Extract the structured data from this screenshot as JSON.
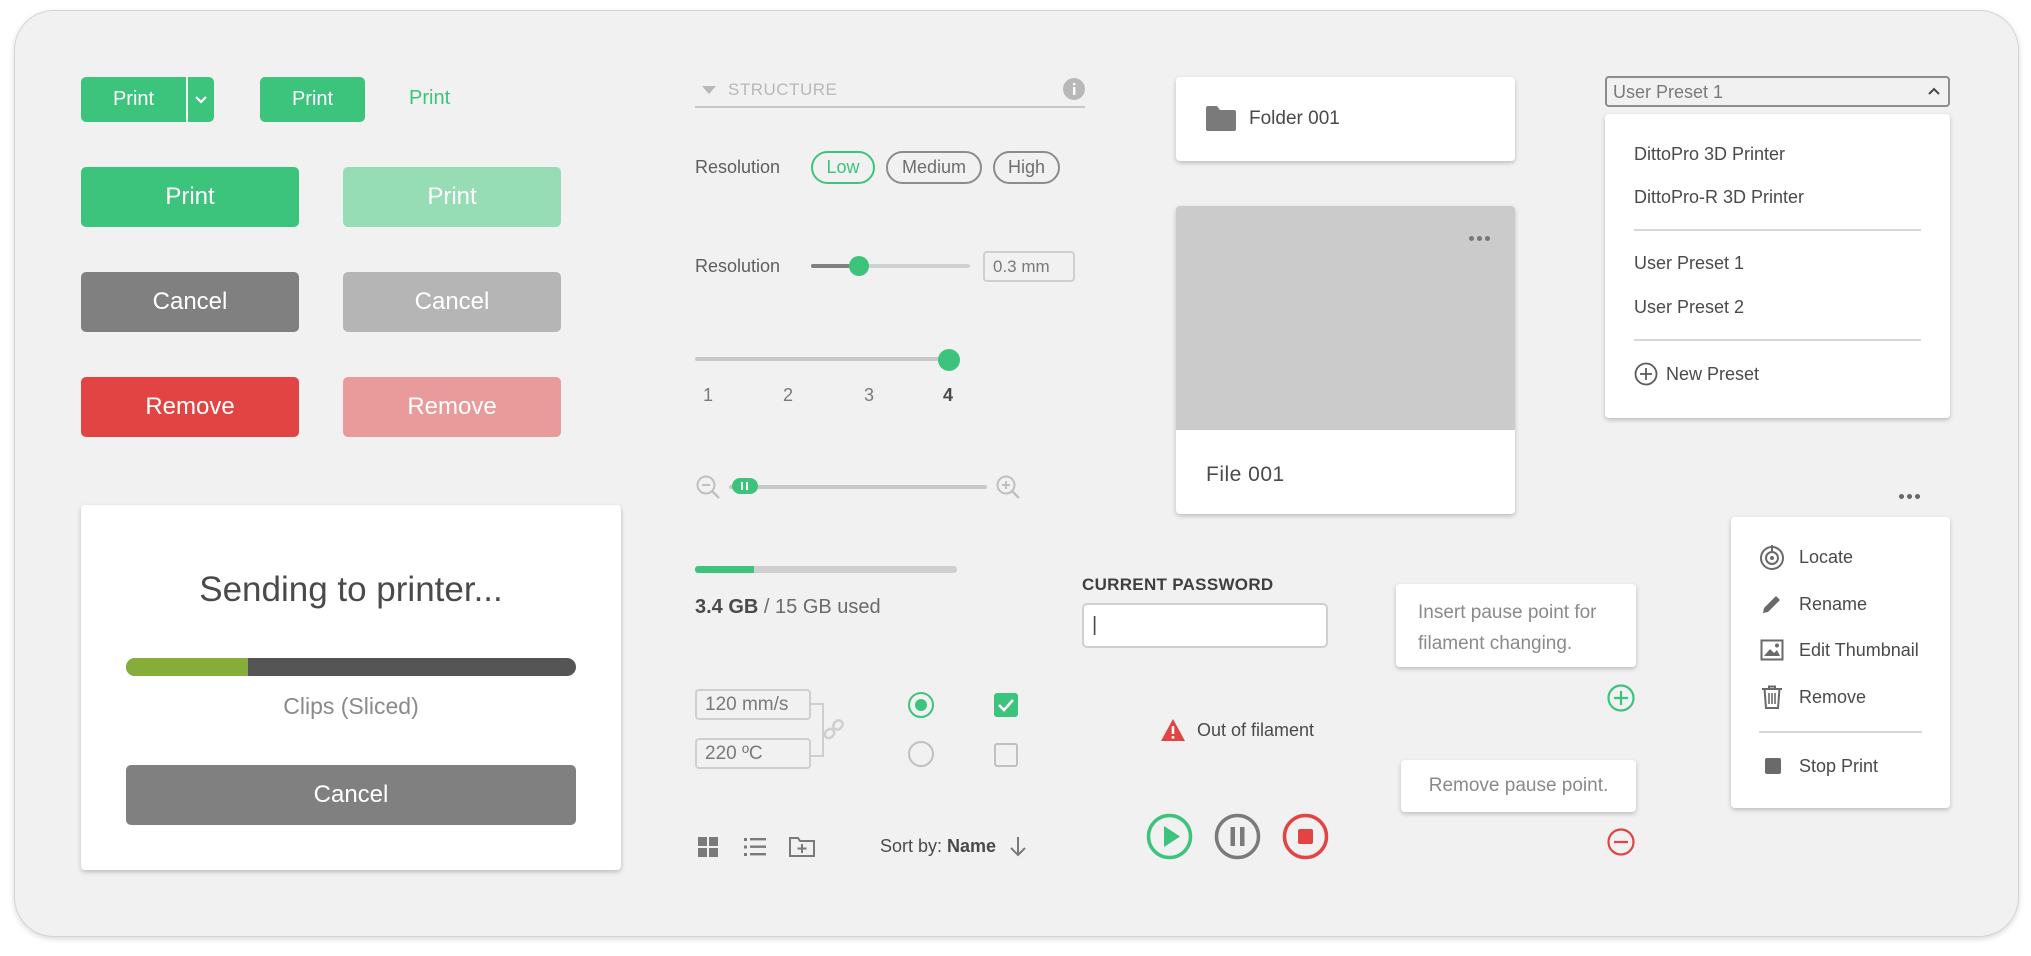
{
  "buttons": {
    "split_print": "Print",
    "print_solid": "Print",
    "print_text": "Print",
    "print_large": "Print",
    "print_large_disabled": "Print",
    "cancel": "Cancel",
    "cancel_disabled": "Cancel",
    "remove": "Remove",
    "remove_disabled": "Remove"
  },
  "sending_dialog": {
    "title": "Sending to printer...",
    "progress": 0.27,
    "file_label": "Clips (Sliced)",
    "cancel_label": "Cancel"
  },
  "structure": {
    "header": "STRUCTURE",
    "resolution_label": "Resolution",
    "options": [
      "Low",
      "Medium",
      "High"
    ],
    "selected": "Low",
    "slider_label": "Resolution",
    "slider_value": 0.3,
    "slider_field_value": "0.3 mm",
    "step_ticks": [
      "1",
      "2",
      "3",
      "4"
    ],
    "step_selected": "4",
    "zoom_value": 0.05
  },
  "storage": {
    "used": "3.4 GB",
    "suffix": " / 15 GB used",
    "fraction": 0.2267
  },
  "linked_fields": {
    "speed": "120 mm/s",
    "temperature": "220 ºC"
  },
  "view_controls": {
    "sort_prefix": "Sort by: ",
    "sort_value": "Name"
  },
  "files": {
    "folder_name": "Folder 001",
    "file_name": "File 001"
  },
  "password": {
    "label": "CURRENT PASSWORD",
    "value": "|"
  },
  "alert": {
    "text": "Out of filament"
  },
  "tooltips": {
    "insert": "Insert pause point for filament changing.",
    "remove": "Remove pause point."
  },
  "preset_dropdown": {
    "selected": "User Preset 1",
    "group1": [
      "DittoPro 3D Printer",
      "DittoPro-R 3D Printer"
    ],
    "group2": [
      "User Preset 1",
      "User Preset 2"
    ],
    "new_label": "New Preset"
  },
  "context_menu": {
    "items": [
      "Locate",
      "Rename",
      "Edit Thumbnail",
      "Remove"
    ],
    "stop_label": "Stop Print"
  },
  "colors": {
    "accent": "#3cc47c",
    "danger": "#e24444",
    "neutral": "#808080",
    "progress_green": "#86ad3a"
  }
}
